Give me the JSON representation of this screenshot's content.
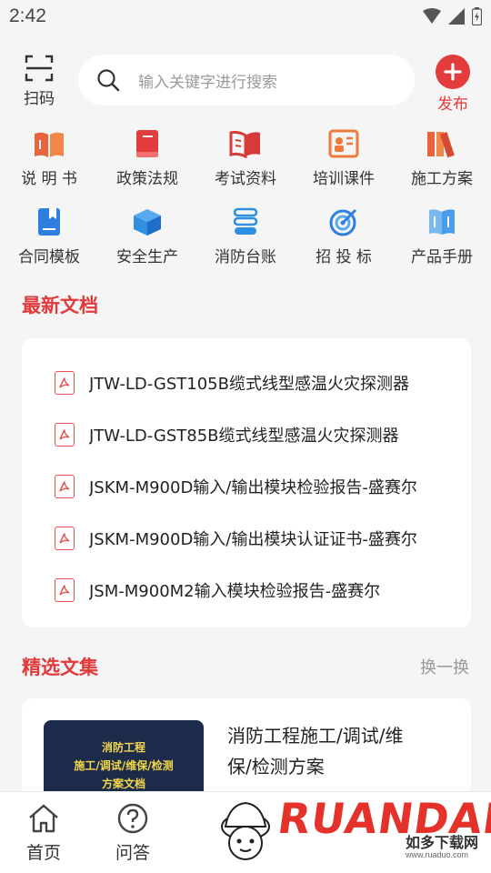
{
  "status_bar": {
    "time": "2:42"
  },
  "top_bar": {
    "scan_label": "扫码",
    "search_placeholder": "输入关键字进行搜索",
    "publish_label": "发布"
  },
  "categories": [
    {
      "label": "说 明 书",
      "icon": "book-open-icon",
      "color": "#e8643c"
    },
    {
      "label": "政策法规",
      "icon": "book-icon",
      "color": "#e23c3c"
    },
    {
      "label": "考试资料",
      "icon": "open-book-icon",
      "color": "#d83a3a"
    },
    {
      "label": "培训课件",
      "icon": "presentation-icon",
      "color": "#ec7a3c"
    },
    {
      "label": "施工方案",
      "icon": "books-icon",
      "color": "#e8643c"
    },
    {
      "label": "合同模板",
      "icon": "contract-icon",
      "color": "#2f7fe0"
    },
    {
      "label": "安全生产",
      "icon": "box-icon",
      "color": "#2f8fe0"
    },
    {
      "label": "消防台账",
      "icon": "ledger-icon",
      "color": "#2f8fe0"
    },
    {
      "label": "招 投 标",
      "icon": "target-icon",
      "color": "#2f7fe0"
    },
    {
      "label": "产品手册",
      "icon": "manual-icon",
      "color": "#4a9de8"
    }
  ],
  "latest": {
    "title": "最新文档",
    "items": [
      "JTW-LD-GST105B缆式线型感温火灾探测器",
      "JTW-LD-GST85B缆式线型感温火灾探测器",
      "JSKM-M900D输入/输出模块检验报告-盛赛尔",
      "JSKM-M900D输入/输出模块认证证书-盛赛尔",
      "JSM-M900M2输入模块检验报告-盛赛尔"
    ]
  },
  "featured": {
    "title": "精选文集",
    "more": "换一换",
    "thumb_lines": [
      "消防工程",
      "施工/调试/维保/检测",
      "方案文档"
    ],
    "item_title_line1": "消防工程施工/调试/维",
    "item_title_line2": "保/检测方案"
  },
  "nav": {
    "home": "首页",
    "qa": "问答"
  },
  "watermark": {
    "brand": "RUANDADO",
    "sub": "如多下载网",
    "url": "www.ruaduo.com"
  },
  "colors": {
    "accent": "#e23c3c",
    "background": "#f5f5f5"
  }
}
